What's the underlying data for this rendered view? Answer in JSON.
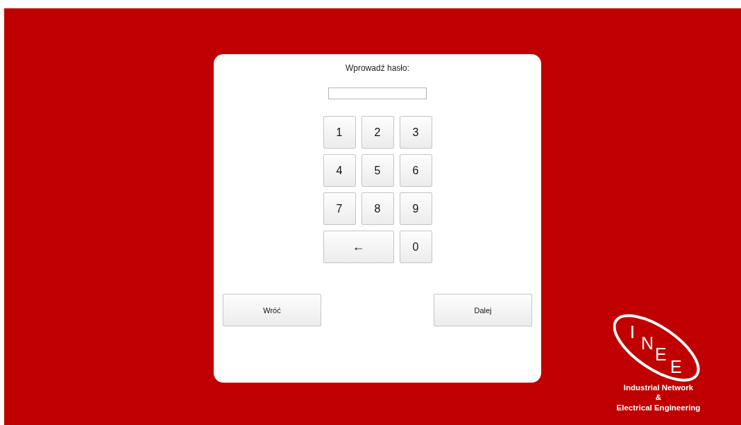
{
  "prompt": "Wprowadź hasło:",
  "keypad": [
    {
      "label": "1",
      "kind": "digit"
    },
    {
      "label": "2",
      "kind": "digit"
    },
    {
      "label": "3",
      "kind": "digit"
    },
    {
      "label": "4",
      "kind": "digit"
    },
    {
      "label": "5",
      "kind": "digit"
    },
    {
      "label": "6",
      "kind": "digit"
    },
    {
      "label": "7",
      "kind": "digit"
    },
    {
      "label": "8",
      "kind": "digit"
    },
    {
      "label": "9",
      "kind": "digit"
    },
    {
      "label": "←",
      "kind": "backspace"
    },
    {
      "label": "0",
      "kind": "digit"
    }
  ],
  "buttons": [
    {
      "label": "Wróć"
    },
    {
      "label": "Dalej"
    }
  ],
  "logo": {
    "letters": [
      "I",
      "N",
      "E",
      "E"
    ],
    "lines": [
      "Industrial Network",
      "&",
      "Electrical Engineering"
    ]
  }
}
